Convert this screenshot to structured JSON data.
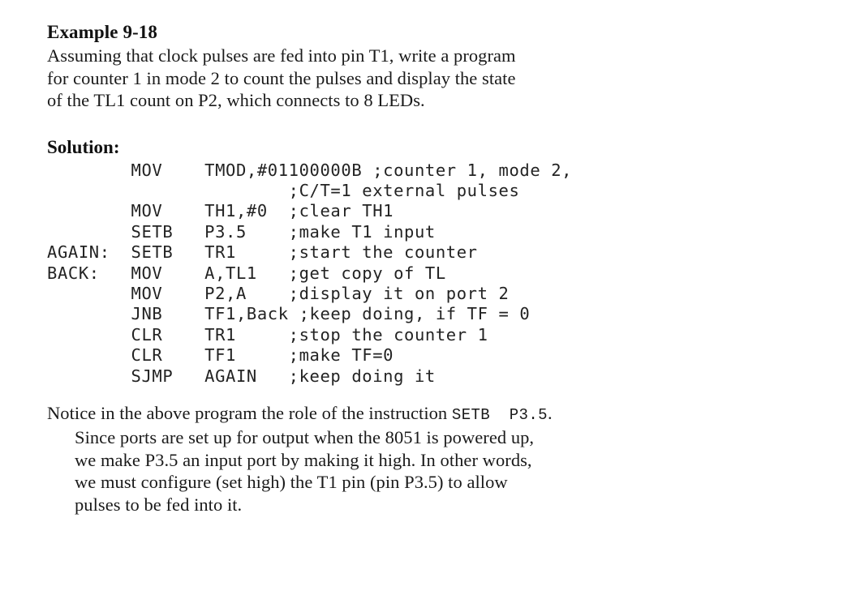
{
  "document": {
    "heading": "Example 9-18",
    "intro_lines": [
      "Assuming that clock pulses are fed into pin T1, write a program",
      "for counter 1 in mode 2 to count the pulses and display the state",
      "of the TL1 count on P2, which connects to 8 LEDs."
    ],
    "solution_label": "Solution:",
    "code_lines": [
      "        MOV    TMOD,#01100000B ;counter 1, mode 2,",
      "                       ;C/T=1 external pulses",
      "        MOV    TH1,#0  ;clear TH1",
      "        SETB   P3.5    ;make T1 input",
      "AGAIN:  SETB   TR1     ;start the counter",
      "BACK:   MOV    A,TL1   ;get copy of TL",
      "        MOV    P2,A    ;display it on port 2",
      "        JNB    TF1,Back ;keep doing, if TF = 0",
      "        CLR    TR1     ;stop the counter 1",
      "        CLR    TF1     ;make TF=0",
      "        SJMP   AGAIN   ;keep doing it"
    ],
    "notice": {
      "line1_before": "Notice in the above program the role of the instruction ",
      "line1_code": "SETB  P3.5",
      "line1_after": ".",
      "line2": "Since ports are set up for output when the 8051 is powered up,",
      "line3": "we make P3.5 an input port by making it high. In other words,",
      "line4": "we must configure (set high) the T1 pin (pin P3.5) to allow",
      "line5": "pulses to be fed into it."
    }
  }
}
